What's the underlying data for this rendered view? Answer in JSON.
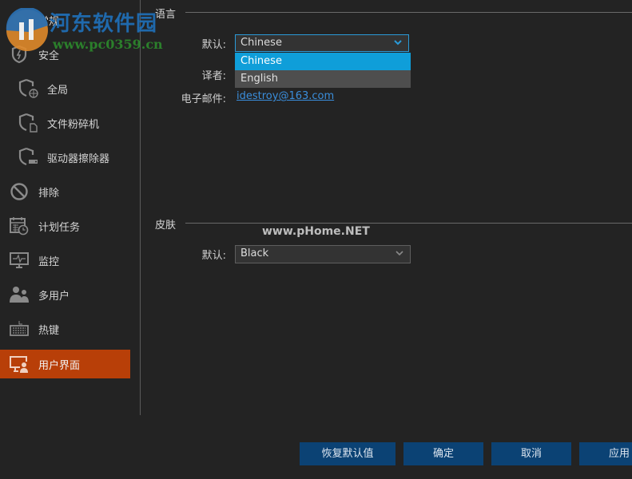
{
  "sidebar": {
    "items": [
      {
        "label": "常规",
        "icon": "gear-icon"
      },
      {
        "label": "安全",
        "icon": "shield-lightning-icon"
      },
      {
        "label": "全局",
        "icon": "shield-globe-icon"
      },
      {
        "label": "文件粉碎机",
        "icon": "shield-file-icon"
      },
      {
        "label": "驱动器擦除器",
        "icon": "shield-drive-icon"
      },
      {
        "label": "排除",
        "icon": "prohibit-icon"
      },
      {
        "label": "计划任务",
        "icon": "calendar-clock-icon"
      },
      {
        "label": "监控",
        "icon": "monitor-pulse-icon"
      },
      {
        "label": "多用户",
        "icon": "users-icon"
      },
      {
        "label": "热键",
        "icon": "keyboard-icon"
      },
      {
        "label": "用户界面",
        "icon": "monitor-user-icon",
        "active": true
      }
    ]
  },
  "language": {
    "title": "语言",
    "default_label": "默认:",
    "default_value": "Chinese",
    "options": [
      "Chinese",
      "English"
    ],
    "translator_label": "译者:",
    "email_label": "电子邮件:",
    "email_value": "idestroy@163.com"
  },
  "skin": {
    "title": "皮肤",
    "default_label": "默认:",
    "default_value": "Black"
  },
  "buttons": {
    "restore_defaults": "恢复默认值",
    "ok": "确定",
    "cancel": "取消",
    "apply": "应用"
  },
  "watermarks": {
    "site_name": "河东软件园",
    "site_url": "www.pc0359.cn",
    "phome": "www.pHome.NET"
  },
  "colors": {
    "accent_active": "#b83f08",
    "button_bg": "#0b4274",
    "dropdown_selected": "#0f9ed9",
    "link": "#3a8edc"
  }
}
